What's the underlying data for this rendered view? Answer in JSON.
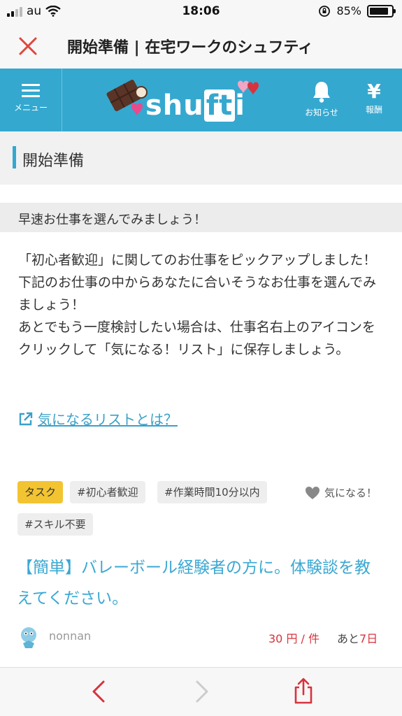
{
  "status_bar": {
    "carrier": "au",
    "time": "18:06",
    "battery": "85%",
    "battery_level": 0.85
  },
  "browser": {
    "title": "開始準備 | 在宅ワークのシュフティ",
    "close_icon": "close-icon",
    "toolbar": {
      "back_icon": "chevron-left-icon",
      "forward_icon": "chevron-right-icon",
      "share_icon": "share-icon"
    }
  },
  "header": {
    "menu_label": "メニュー",
    "logo_text_1": "shu",
    "logo_text_2": "ft",
    "logo_text_3": "i",
    "notice_label": "お知らせ",
    "reward_symbol": "¥",
    "reward_label": "報酬",
    "brand_color": "#35a8cf"
  },
  "section": {
    "title": "開始準備"
  },
  "intro": {
    "heading": "早速お仕事を選んでみましょう！",
    "body": [
      "「初心者歓迎」に関してのお仕事をピックアップしました！",
      "下記のお仕事の中からあなたに合いそうなお仕事を選んでみましょう！",
      "あとでもう一度検討したい場合は、仕事名右上のアイコンをクリックして「気になる！リスト」に保存しましょう。"
    ],
    "link_text": "気になるリストとは？"
  },
  "job": {
    "type_tag": "タスク",
    "tags": [
      "#初心者歓迎",
      "#作業時間10分以内",
      "#スキル不要"
    ],
    "fav_label": "気になる！",
    "title": "【簡単】バレーボール経験者の方に。体験談を教えてください。",
    "author": "nonnan",
    "price": "30 円 / 件",
    "deadline_prefix": "あと",
    "deadline_value": "7日"
  }
}
